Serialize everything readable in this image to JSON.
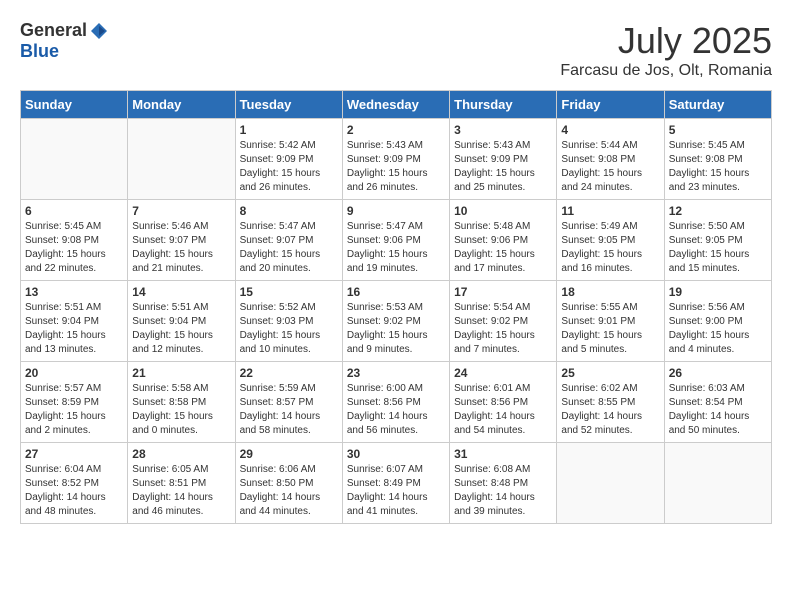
{
  "header": {
    "logo_general": "General",
    "logo_blue": "Blue",
    "month_title": "July 2025",
    "subtitle": "Farcasu de Jos, Olt, Romania"
  },
  "days_of_week": [
    "Sunday",
    "Monday",
    "Tuesday",
    "Wednesday",
    "Thursday",
    "Friday",
    "Saturday"
  ],
  "weeks": [
    [
      {
        "day": "",
        "info": ""
      },
      {
        "day": "",
        "info": ""
      },
      {
        "day": "1",
        "info": "Sunrise: 5:42 AM\nSunset: 9:09 PM\nDaylight: 15 hours and 26 minutes."
      },
      {
        "day": "2",
        "info": "Sunrise: 5:43 AM\nSunset: 9:09 PM\nDaylight: 15 hours and 26 minutes."
      },
      {
        "day": "3",
        "info": "Sunrise: 5:43 AM\nSunset: 9:09 PM\nDaylight: 15 hours and 25 minutes."
      },
      {
        "day": "4",
        "info": "Sunrise: 5:44 AM\nSunset: 9:08 PM\nDaylight: 15 hours and 24 minutes."
      },
      {
        "day": "5",
        "info": "Sunrise: 5:45 AM\nSunset: 9:08 PM\nDaylight: 15 hours and 23 minutes."
      }
    ],
    [
      {
        "day": "6",
        "info": "Sunrise: 5:45 AM\nSunset: 9:08 PM\nDaylight: 15 hours and 22 minutes."
      },
      {
        "day": "7",
        "info": "Sunrise: 5:46 AM\nSunset: 9:07 PM\nDaylight: 15 hours and 21 minutes."
      },
      {
        "day": "8",
        "info": "Sunrise: 5:47 AM\nSunset: 9:07 PM\nDaylight: 15 hours and 20 minutes."
      },
      {
        "day": "9",
        "info": "Sunrise: 5:47 AM\nSunset: 9:06 PM\nDaylight: 15 hours and 19 minutes."
      },
      {
        "day": "10",
        "info": "Sunrise: 5:48 AM\nSunset: 9:06 PM\nDaylight: 15 hours and 17 minutes."
      },
      {
        "day": "11",
        "info": "Sunrise: 5:49 AM\nSunset: 9:05 PM\nDaylight: 15 hours and 16 minutes."
      },
      {
        "day": "12",
        "info": "Sunrise: 5:50 AM\nSunset: 9:05 PM\nDaylight: 15 hours and 15 minutes."
      }
    ],
    [
      {
        "day": "13",
        "info": "Sunrise: 5:51 AM\nSunset: 9:04 PM\nDaylight: 15 hours and 13 minutes."
      },
      {
        "day": "14",
        "info": "Sunrise: 5:51 AM\nSunset: 9:04 PM\nDaylight: 15 hours and 12 minutes."
      },
      {
        "day": "15",
        "info": "Sunrise: 5:52 AM\nSunset: 9:03 PM\nDaylight: 15 hours and 10 minutes."
      },
      {
        "day": "16",
        "info": "Sunrise: 5:53 AM\nSunset: 9:02 PM\nDaylight: 15 hours and 9 minutes."
      },
      {
        "day": "17",
        "info": "Sunrise: 5:54 AM\nSunset: 9:02 PM\nDaylight: 15 hours and 7 minutes."
      },
      {
        "day": "18",
        "info": "Sunrise: 5:55 AM\nSunset: 9:01 PM\nDaylight: 15 hours and 5 minutes."
      },
      {
        "day": "19",
        "info": "Sunrise: 5:56 AM\nSunset: 9:00 PM\nDaylight: 15 hours and 4 minutes."
      }
    ],
    [
      {
        "day": "20",
        "info": "Sunrise: 5:57 AM\nSunset: 8:59 PM\nDaylight: 15 hours and 2 minutes."
      },
      {
        "day": "21",
        "info": "Sunrise: 5:58 AM\nSunset: 8:58 PM\nDaylight: 15 hours and 0 minutes."
      },
      {
        "day": "22",
        "info": "Sunrise: 5:59 AM\nSunset: 8:57 PM\nDaylight: 14 hours and 58 minutes."
      },
      {
        "day": "23",
        "info": "Sunrise: 6:00 AM\nSunset: 8:56 PM\nDaylight: 14 hours and 56 minutes."
      },
      {
        "day": "24",
        "info": "Sunrise: 6:01 AM\nSunset: 8:56 PM\nDaylight: 14 hours and 54 minutes."
      },
      {
        "day": "25",
        "info": "Sunrise: 6:02 AM\nSunset: 8:55 PM\nDaylight: 14 hours and 52 minutes."
      },
      {
        "day": "26",
        "info": "Sunrise: 6:03 AM\nSunset: 8:54 PM\nDaylight: 14 hours and 50 minutes."
      }
    ],
    [
      {
        "day": "27",
        "info": "Sunrise: 6:04 AM\nSunset: 8:52 PM\nDaylight: 14 hours and 48 minutes."
      },
      {
        "day": "28",
        "info": "Sunrise: 6:05 AM\nSunset: 8:51 PM\nDaylight: 14 hours and 46 minutes."
      },
      {
        "day": "29",
        "info": "Sunrise: 6:06 AM\nSunset: 8:50 PM\nDaylight: 14 hours and 44 minutes."
      },
      {
        "day": "30",
        "info": "Sunrise: 6:07 AM\nSunset: 8:49 PM\nDaylight: 14 hours and 41 minutes."
      },
      {
        "day": "31",
        "info": "Sunrise: 6:08 AM\nSunset: 8:48 PM\nDaylight: 14 hours and 39 minutes."
      },
      {
        "day": "",
        "info": ""
      },
      {
        "day": "",
        "info": ""
      }
    ]
  ]
}
